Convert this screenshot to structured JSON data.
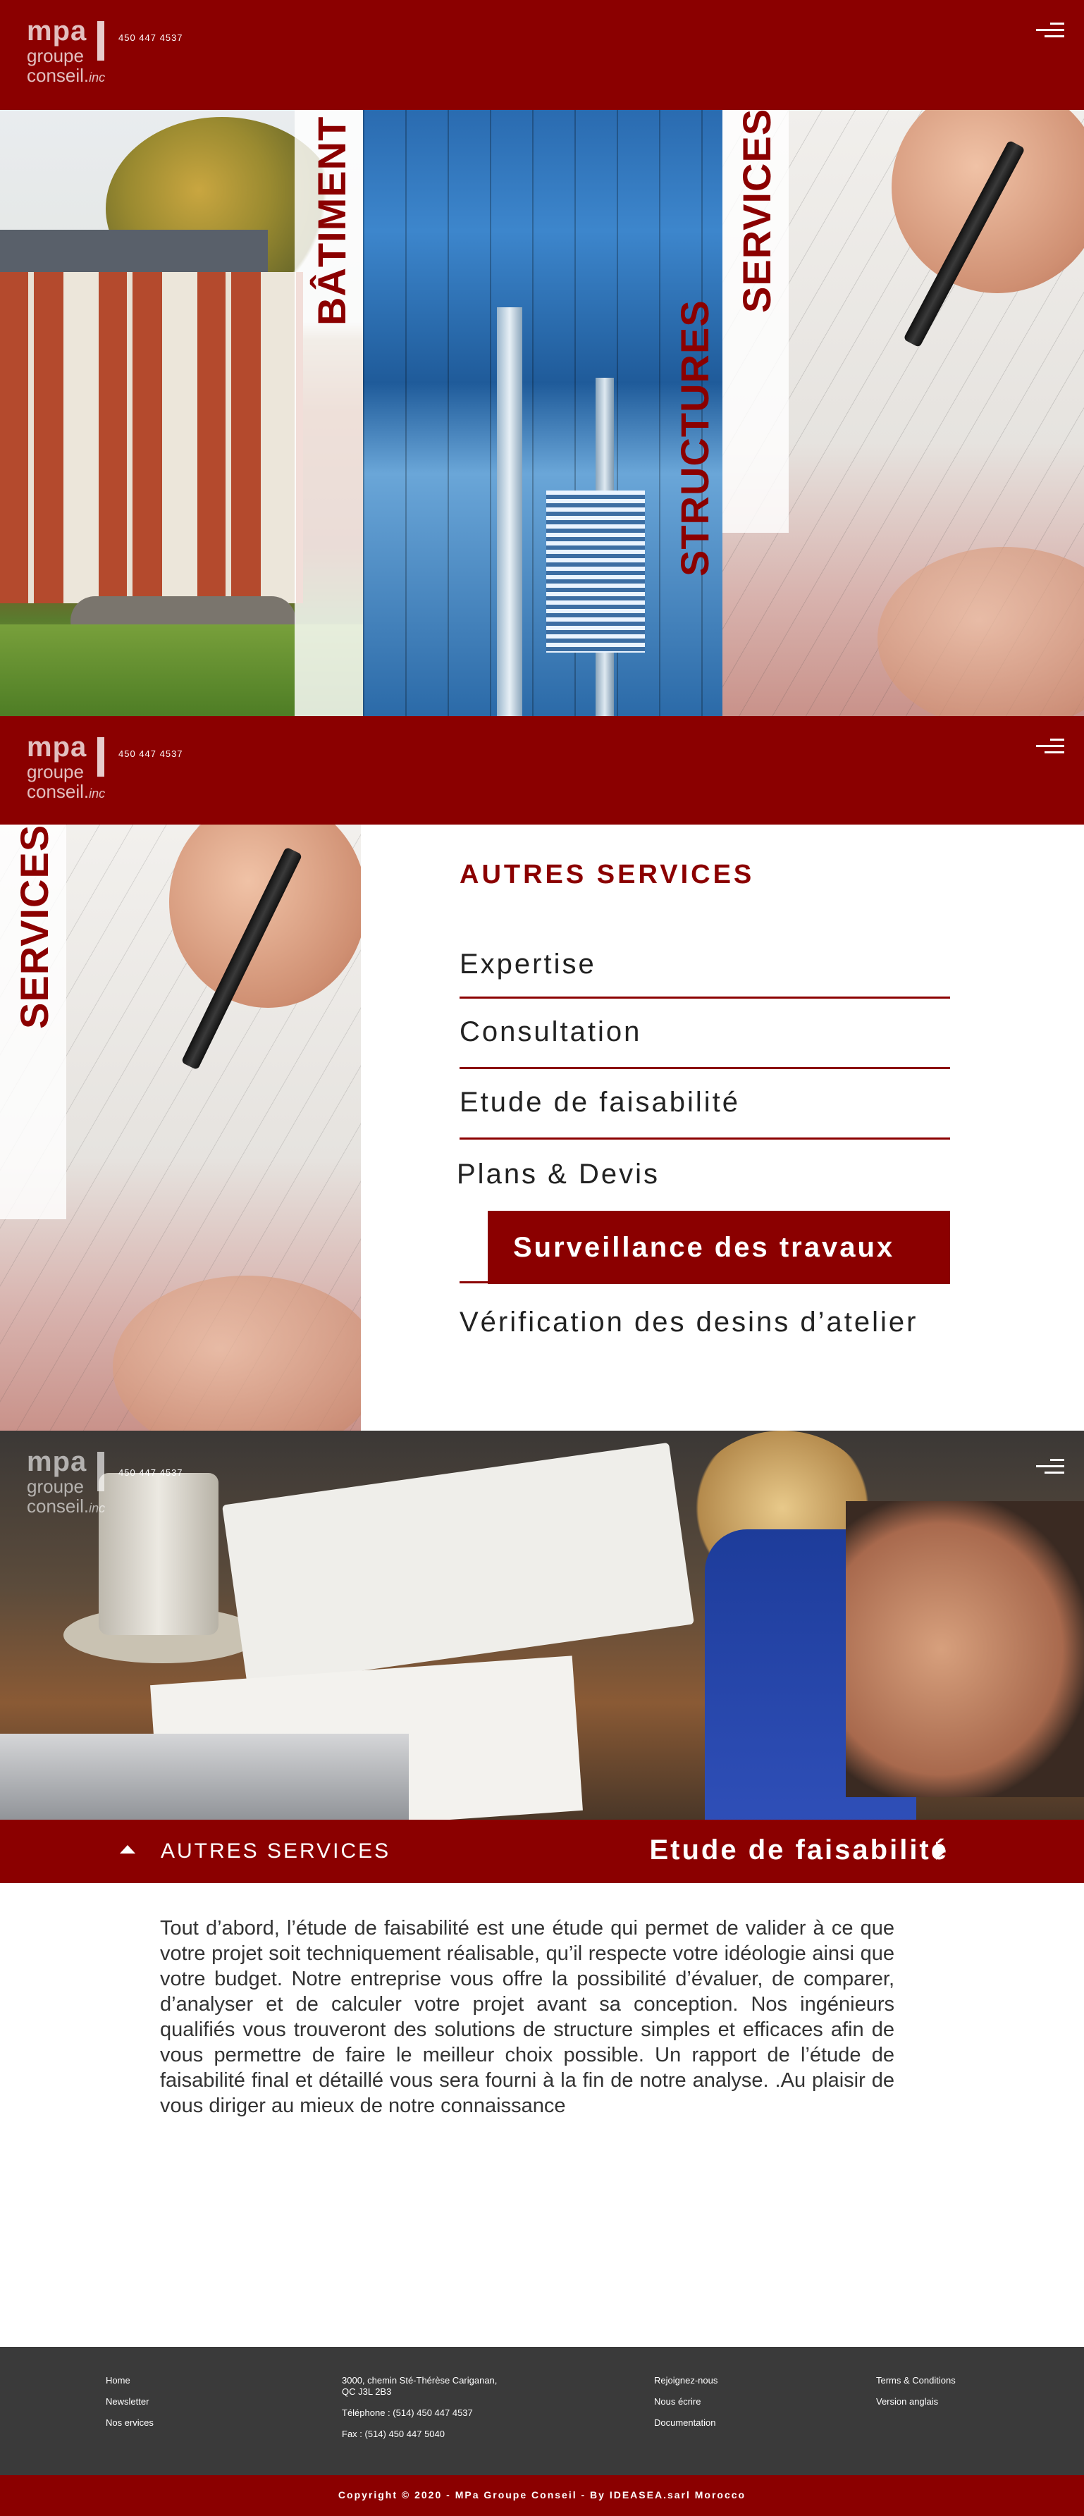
{
  "header": {
    "logo_mpa": "mpa",
    "logo_line2": "groupe",
    "logo_line3": "conseil.",
    "logo_inc": "inc",
    "phone": "450 447 4537"
  },
  "hero": {
    "panels": [
      "BÂTIMENT",
      "STRUCTURES",
      "SERVICES"
    ]
  },
  "services_section": {
    "side_label": "SERVICES",
    "title": "AUTRES SERVICES",
    "items": [
      "Expertise",
      "Consultation",
      "Etude de faisabilité",
      "Plans & Devis",
      "Surveillance des travaux",
      "Vérification des desins d’atelier"
    ]
  },
  "breadcrumb": {
    "back_label": "AUTRES SERVICES",
    "current": "Etude de faisabilité"
  },
  "content": {
    "paragraph": "Tout d’abord, l’étude de faisabilité est une étude qui permet de valider à ce que votre projet soit techniquement réalisable, qu’il respecte votre idéologie ainsi que votre budget. Notre entreprise vous offre la possibilité d’évaluer, de comparer, d’analyser et de calculer votre projet avant sa conception. Nos ingénieurs qualifiés vous trouveront des solutions de structure simples et efficaces afin de vous permettre de faire le meilleur choix possible. Un rapport de l’étude de faisabilité final et détaillé vous sera fourni à la fin de notre analyse. .Au plaisir de vous diriger au mieux de notre connaissance"
  },
  "footer": {
    "col1": [
      "Home",
      "Newsletter",
      "Nos ervices"
    ],
    "col2_address1": "3000, chemin Sté-Thérèse Cariganan,",
    "col2_address2": "QC J3L 2B3",
    "col2_phone": "Téléphone : (514) 450 447 4537",
    "col2_fax": "Fax : (514) 450 447 5040",
    "col3": [
      "Rejoignez-nous",
      "Nous écrire",
      "Documentation"
    ],
    "col4": [
      "Terms & Conditions",
      "Version anglais"
    ],
    "copyright": "Copyright © 2020 - MPa Groupe Conseil - By IDEASEA.sarl Morocco"
  },
  "colors": {
    "brand_red": "#8b0000",
    "footer_gray": "#3a3a3a"
  }
}
